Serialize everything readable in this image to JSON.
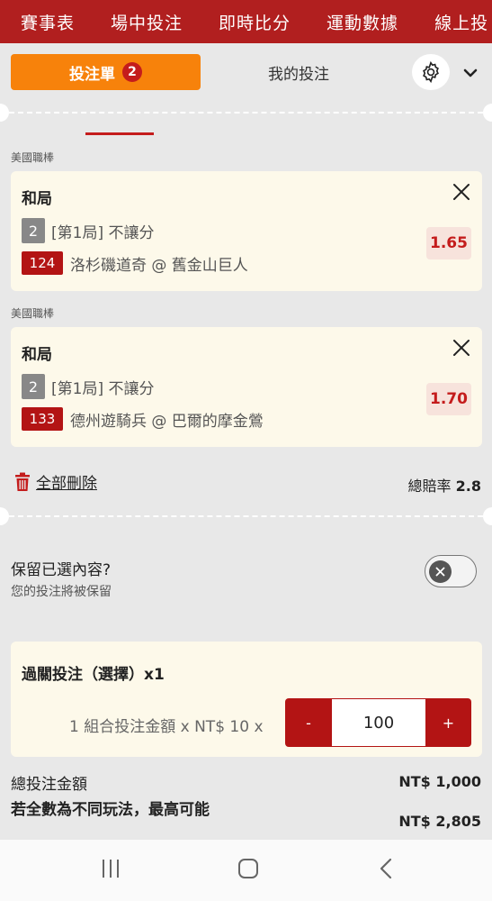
{
  "topnav": {
    "items": [
      "賽事表",
      "場中投注",
      "即時比分",
      "運動數據",
      "線上投"
    ]
  },
  "tabs": {
    "betslip_label": "投注單",
    "betslip_count": "2",
    "mybets_label": "我的投注"
  },
  "bets": [
    {
      "league": "美國職棒",
      "pick": "和局",
      "period_num": "2",
      "market": "[第1局] 不讓分",
      "event_id": "124",
      "match": "洛杉磯道奇 @ 舊金山巨人",
      "odds": "1.65"
    },
    {
      "league": "美國職棒",
      "pick": "和局",
      "period_num": "2",
      "market": "[第1局] 不讓分",
      "event_id": "133",
      "match": "德州遊騎兵 @ 巴爾的摩金鶯",
      "odds": "1.70"
    }
  ],
  "actions": {
    "delete_all": "全部刪除",
    "total_odds_label": "總賠率",
    "total_odds_value": "2.8"
  },
  "keep": {
    "title": "保留已選內容?",
    "subtitle": "您的投注將被保留",
    "enabled": false
  },
  "combo": {
    "title": "過關投注（選擇）x1",
    "description": "1 組合投注金額 x NT$ 10 x",
    "minus": "-",
    "amount": "100",
    "plus": "+"
  },
  "summary": {
    "total_label": "總投注金額",
    "total_value": "NT$ 1,000",
    "max_label": "若全數為不同玩法，最高可能",
    "max_value": "NT$ 2,805"
  },
  "colors": {
    "brand_red": "#b11f1f",
    "accent_orange": "#f7820b",
    "odds_red": "#c41c1c"
  }
}
